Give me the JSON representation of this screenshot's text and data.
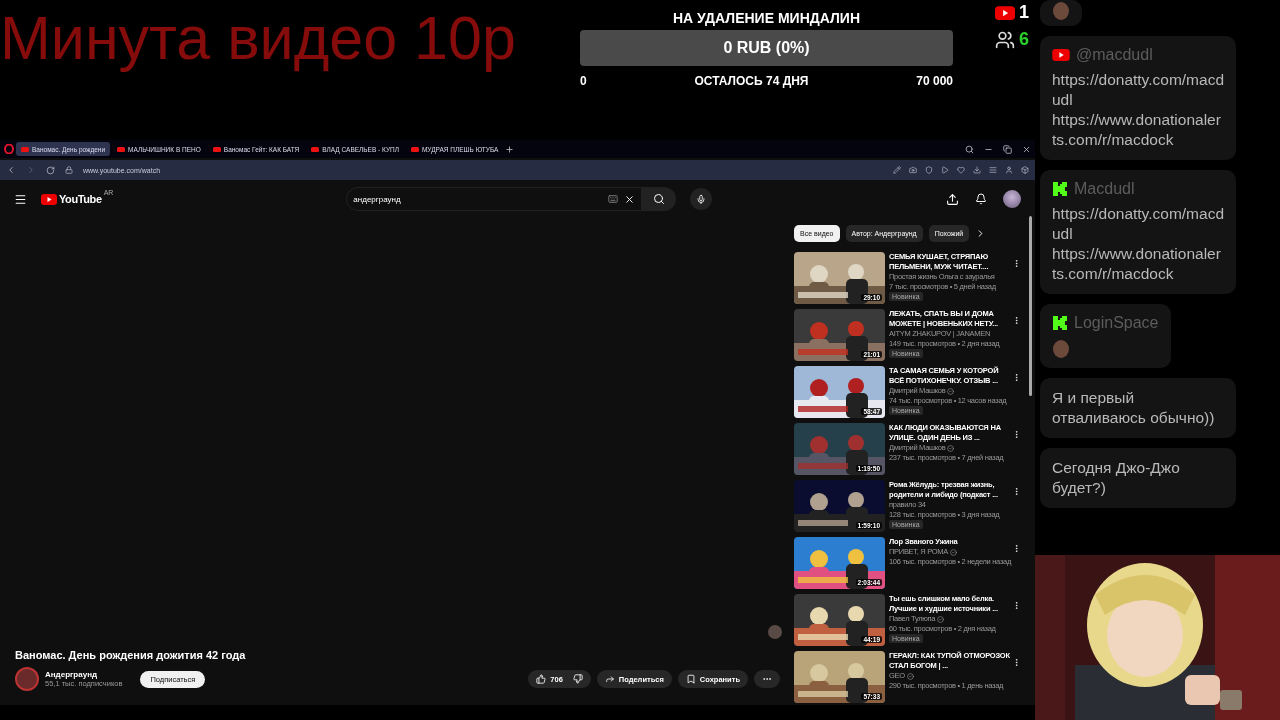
{
  "overlay": {
    "title": "Минута видео 10р",
    "goal": {
      "title": "НА УДАЛЕНИЕ МИНДАЛИН",
      "amount": "0 RUB (0%)",
      "min": "0",
      "remaining": "ОСТАЛОСЬ 74 ДНЯ",
      "max": "70 000"
    },
    "counters": [
      {
        "kind": "youtube",
        "value": "1"
      },
      {
        "kind": "viewers",
        "value": "6"
      }
    ]
  },
  "browser": {
    "tabs": [
      {
        "title": "Ваномас. День рождени",
        "selected": true
      },
      {
        "title": "МАЛЬЧИШНИК В ПЕНО",
        "selected": false
      },
      {
        "title": "Ваномас Гейт: КАК БАТЯ",
        "selected": false
      },
      {
        "title": "ВЛАД САВЕЛЬЕВ - КУПЛ",
        "selected": false
      },
      {
        "title": "МУДРАЯ ПЛЕШЬ ЮТУБА",
        "selected": false
      }
    ],
    "url": "www.youtube.com/watch"
  },
  "youtube": {
    "logo": "YouTube",
    "region": "AR",
    "search": "андерграунд",
    "chips": [
      {
        "label": "Все видео",
        "selected": true
      },
      {
        "label": "Автор: Андерграунд",
        "selected": false
      },
      {
        "label": "Похожий",
        "selected": false
      }
    ],
    "videos": [
      {
        "title": "СЕМЬЯ КУШАЕТ, СТРЯПАЮ ПЕЛЬМЕНИ, МУЖ ЧИТАЕТ....",
        "channel": "Простая жизнь Ольга с зауралья",
        "verified": false,
        "meta": "7 тыс. просмотров • 5 дней назад",
        "badge": "Новинка",
        "duration": "29:10"
      },
      {
        "title": "ЛЕЖАТЬ, СПАТЬ ВЫ И ДОМА МОЖЕТЕ | НОВЕНЬКИХ НЕТУ...",
        "channel": "AITYM ZHAKUPOV | JANAMEN",
        "verified": false,
        "meta": "149 тыс. просмотров • 2 дня назад",
        "badge": "Новинка",
        "duration": "21:01"
      },
      {
        "title": "ТА САМАЯ СЕМЬЯ У КОТОРОЙ ВСЁ ПОТИХОНЕЧКУ. ОТЗЫВ ...",
        "channel": "Дмитрий Машков",
        "verified": true,
        "meta": "74 тыс. просмотров • 12 часов назад",
        "badge": "Новинка",
        "duration": "58:47"
      },
      {
        "title": "КАК ЛЮДИ ОКАЗЫВАЮТСЯ НА УЛИЦЕ. ОДИН ДЕНЬ ИЗ ...",
        "channel": "Дмитрий Машков",
        "verified": true,
        "meta": "237 тыс. просмотров • 7 дней назад",
        "duration": "1:19:50"
      },
      {
        "title": "Рома Жёлудь: трезвая жизнь, родители и либидо (подкаст ...",
        "channel": "правило 34",
        "verified": false,
        "meta": "128 тыс. просмотров • 3 дня назад",
        "badge": "Новинка",
        "duration": "1:59:10"
      },
      {
        "title": "Лор Званого Ужина",
        "channel": "ПРИВЕТ, Я РОМА",
        "verified": true,
        "meta": "106 тыс. просмотров • 2 недели назад",
        "duration": "2:03:44"
      },
      {
        "title": "Ты ешь слишком мало белка. Лучшие и худшие источники ...",
        "channel": "Павел Тулюпа",
        "verified": true,
        "meta": "60 тыс. просмотров • 2 дня назад",
        "badge": "Новинка",
        "duration": "44:19"
      },
      {
        "title": "ГЕРАКЛ: КАК ТУПОЙ ОТМОРОЗОК СТАЛ БОГОМ | ...",
        "channel": "GEO",
        "verified": true,
        "meta": "290 тыс. просмотров • 1 день назад",
        "duration": "57:33"
      }
    ],
    "video": {
      "title": "Ваномас. День рождения дожития 42 года",
      "channel": "Андерграунд",
      "subscribers": "55,1 тыс. подписчиков",
      "subscribe": "Подписаться",
      "likes": "706",
      "share": "Поделиться",
      "save": "Сохранить"
    }
  },
  "chat": [
    {
      "kind": "emote"
    },
    {
      "kind": "text",
      "author": {
        "kind": "youtube",
        "name": "@macdudl"
      },
      "text": "https://donatty.com/macdudl https://www.donationalerts.com/r/macdock"
    },
    {
      "kind": "text",
      "author": {
        "kind": "kick",
        "name": "Macdudl"
      },
      "text": "https://donatty.com/macdudl https://www.donationalerts.com/r/macdock"
    },
    {
      "kind": "emote",
      "author": {
        "kind": "kick",
        "name": "LoginSpace"
      }
    },
    {
      "kind": "text",
      "text": "Я и первый отваливаюсь обычно))"
    },
    {
      "kind": "text",
      "text": "Сегодня Джо-Джо будет?)"
    }
  ]
}
